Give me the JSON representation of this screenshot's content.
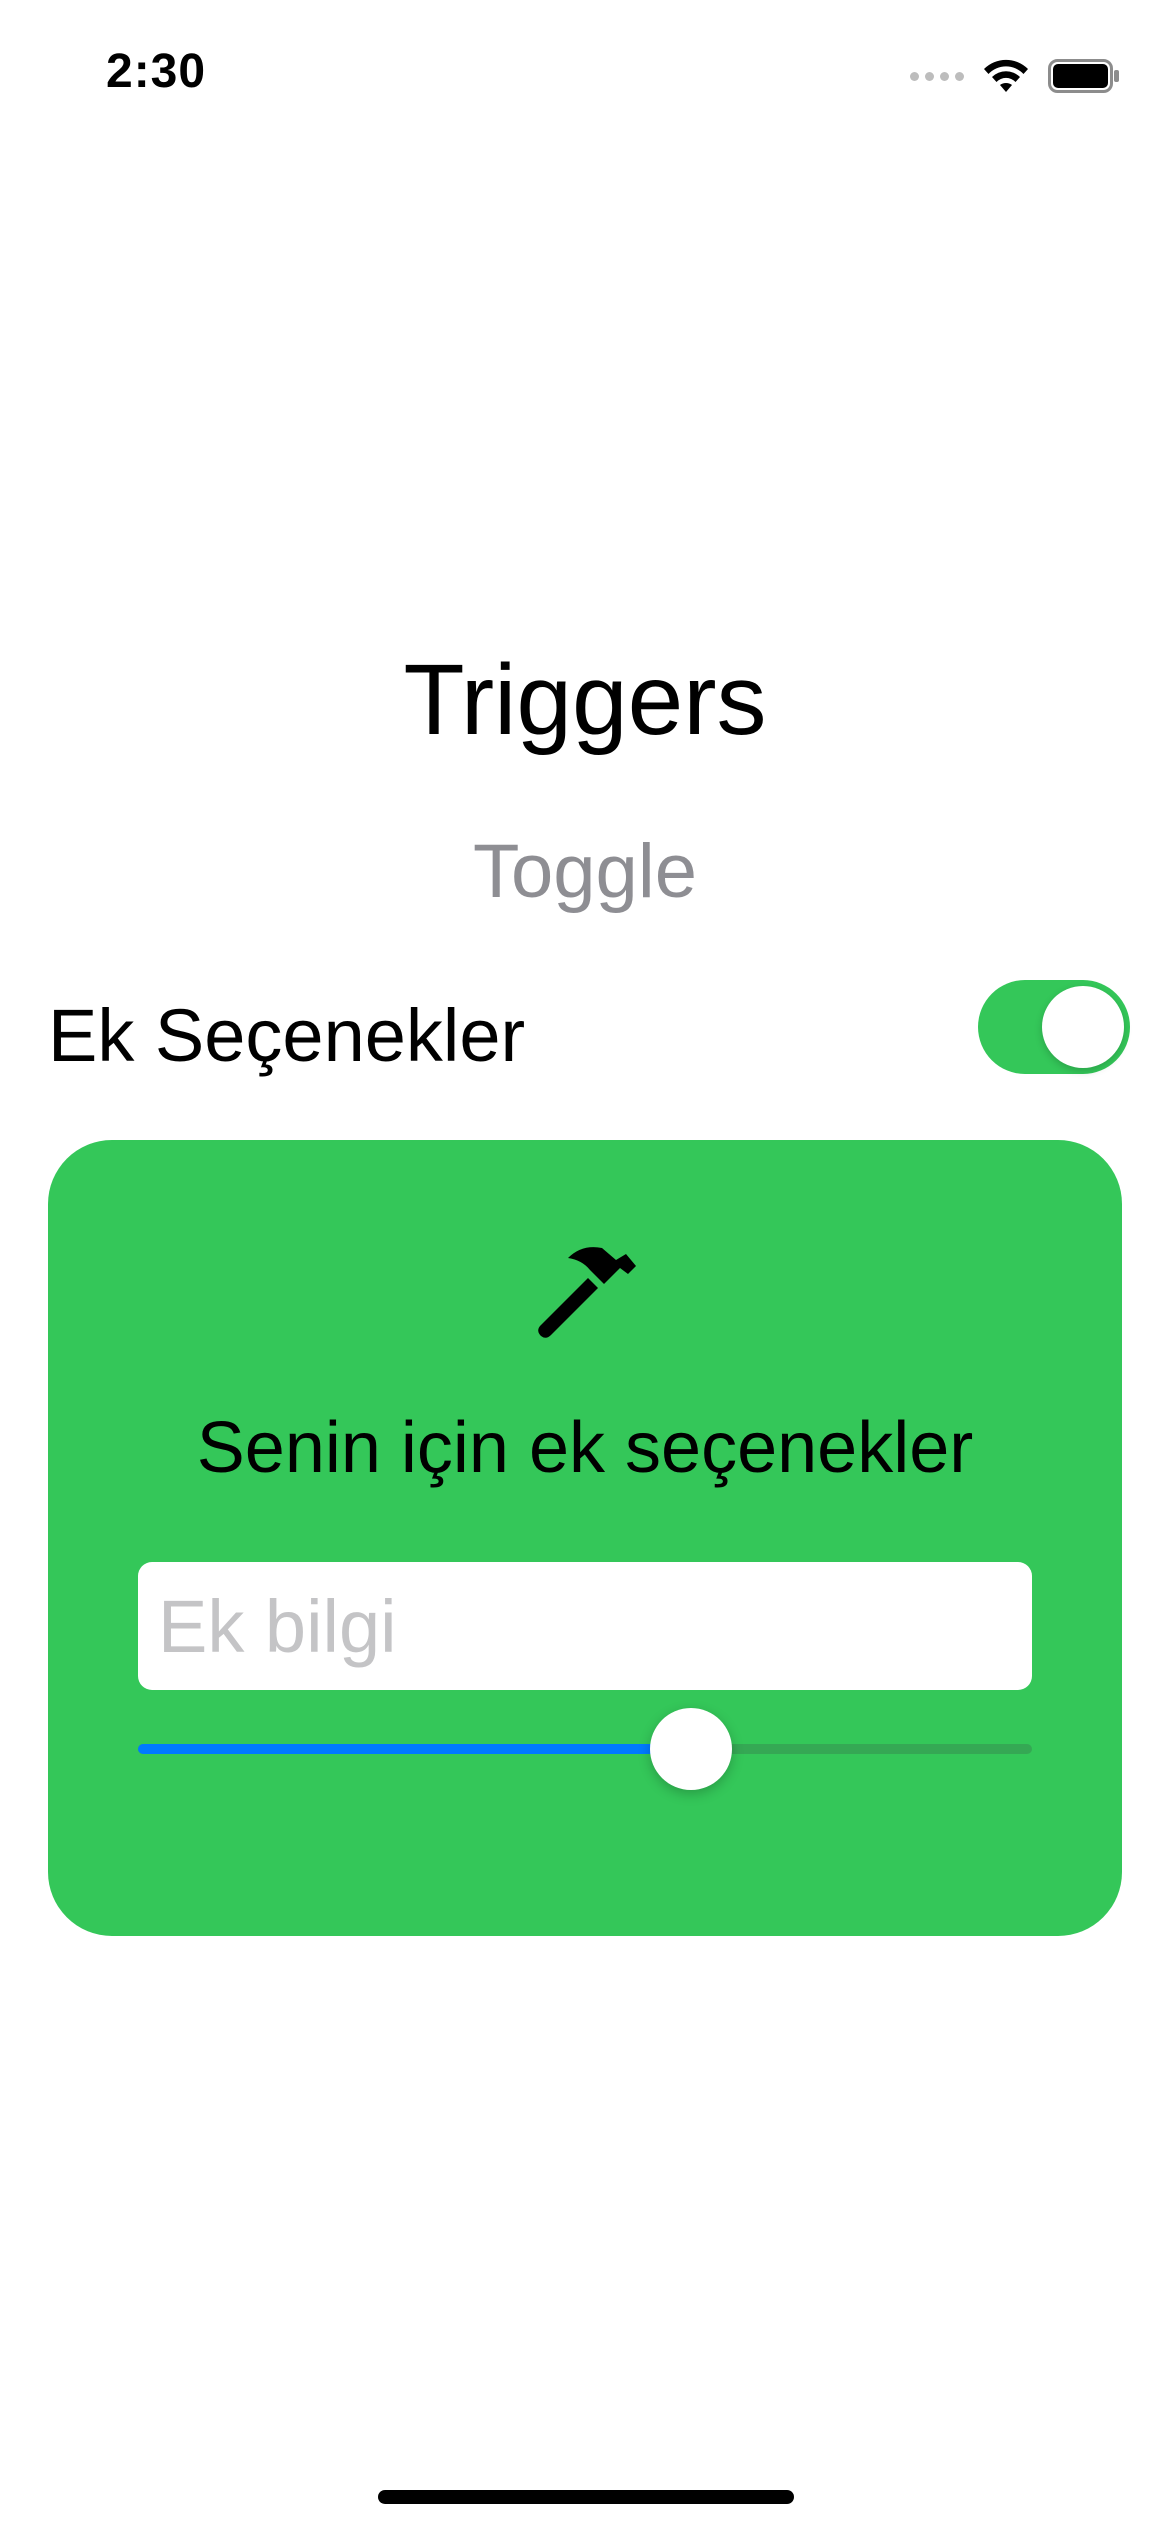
{
  "status_bar": {
    "time": "2:30",
    "icons": [
      "signal-icon",
      "wifi-icon",
      "battery-icon"
    ]
  },
  "title": "Triggers",
  "subtitle": "Toggle",
  "toggle": {
    "label": "Ek Seçenekler",
    "on": true,
    "color": "#34c759"
  },
  "card": {
    "background": "#34c759",
    "icon": "hammer-icon",
    "heading": "Senin için ek seçenekler",
    "text_field": {
      "value": "",
      "placeholder": "Ek bilgi"
    },
    "slider": {
      "value": 0.63,
      "min": 0,
      "max": 1,
      "tint": "#007aff"
    }
  }
}
